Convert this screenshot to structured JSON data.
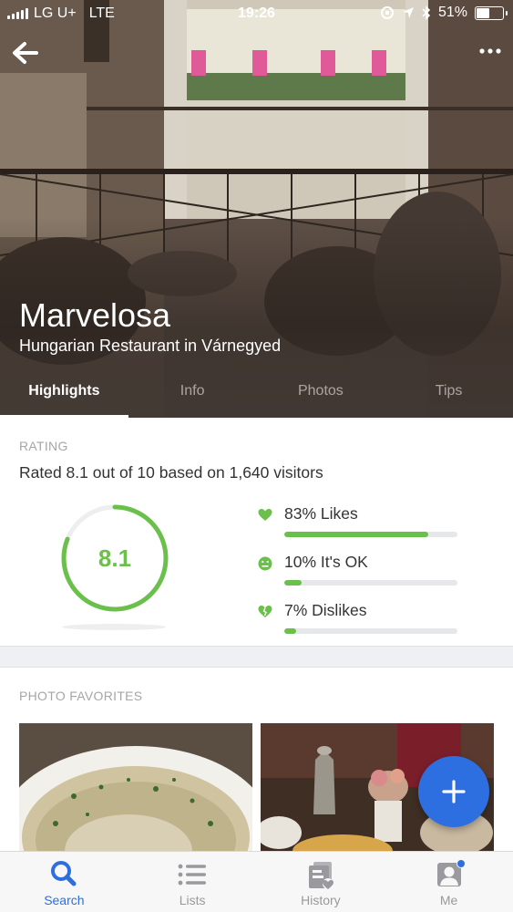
{
  "status_bar": {
    "carrier": "LG U+",
    "network": "LTE",
    "time": "19:26",
    "battery_text": "51%",
    "battery_level": 0.51
  },
  "header": {
    "back_icon": "back-arrow-icon",
    "more_icon": "more-dots-icon"
  },
  "venue": {
    "name": "Marvelosa",
    "subtitle": "Hungarian Restaurant in Várnegyed"
  },
  "tabs": [
    {
      "label": "Highlights",
      "active": true
    },
    {
      "label": "Info",
      "active": false
    },
    {
      "label": "Photos",
      "active": false
    },
    {
      "label": "Tips",
      "active": false
    }
  ],
  "rating": {
    "section_label": "RATING",
    "summary": "Rated 8.1 out of 10 based on 1,640 visitors",
    "score": "8.1",
    "score_value": 8.1,
    "score_max": 10,
    "color": "#6bc04b",
    "breakdown": [
      {
        "label": "83% Likes",
        "percent": 83,
        "icon": "heart-icon"
      },
      {
        "label": "10% It's OK",
        "percent": 10,
        "icon": "neutral-face-icon"
      },
      {
        "label": "7% Dislikes",
        "percent": 7,
        "icon": "broken-heart-icon"
      }
    ]
  },
  "photos": {
    "section_label": "PHOTO FAVORITES"
  },
  "fab": {
    "icon": "plus-icon",
    "color": "#2d6ee0"
  },
  "bottom_nav": [
    {
      "label": "Search",
      "icon": "search-icon",
      "active": true
    },
    {
      "label": "Lists",
      "icon": "list-icon",
      "active": false
    },
    {
      "label": "History",
      "icon": "history-icon",
      "active": false
    },
    {
      "label": "Me",
      "icon": "profile-icon",
      "active": false
    }
  ]
}
